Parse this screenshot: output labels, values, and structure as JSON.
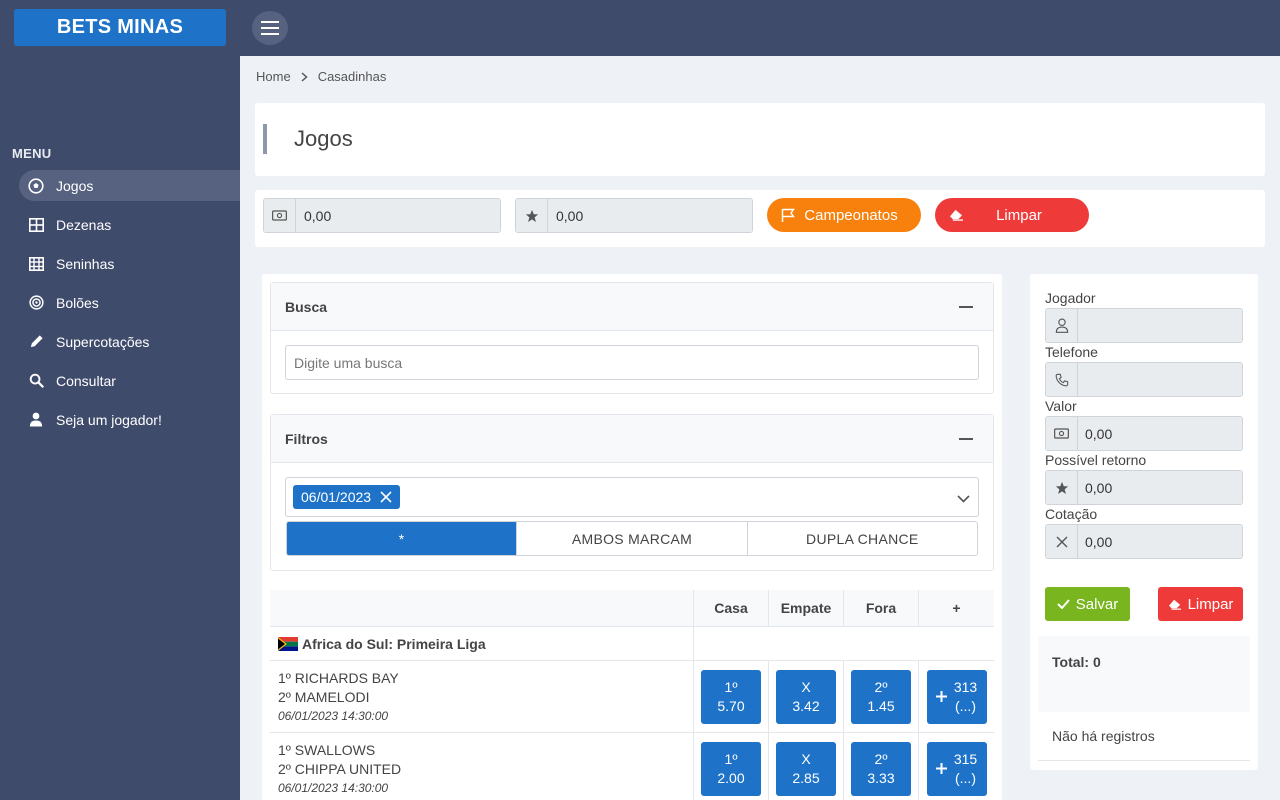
{
  "brand": "BETS MINAS",
  "sidebar": {
    "menu_label": "MENU",
    "items": [
      {
        "label": "Jogos",
        "icon": "soccer-ball-icon"
      },
      {
        "label": "Dezenas",
        "icon": "grid-icon"
      },
      {
        "label": "Seninhas",
        "icon": "table-icon"
      },
      {
        "label": "Bolões",
        "icon": "target-icon"
      },
      {
        "label": "Supercotações",
        "icon": "pencil-icon"
      },
      {
        "label": "Consultar",
        "icon": "search-icon"
      },
      {
        "label": "Seja um jogador!",
        "icon": "user-icon"
      }
    ]
  },
  "breadcrumb": {
    "home": "Home",
    "current": "Casadinhas"
  },
  "page_title": "Jogos",
  "toolbar": {
    "valor": "0,00",
    "retorno": "0,00",
    "campeonatos_label": "Campeonatos",
    "limpar_label": "Limpar"
  },
  "busca": {
    "title": "Busca",
    "placeholder": "Digite uma busca"
  },
  "filtros": {
    "title": "Filtros",
    "selected_date": "06/01/2023",
    "tabs": [
      "*",
      "AMBOS MARCAM",
      "DUPLA CHANCE"
    ]
  },
  "games_table": {
    "headers": [
      "Casa",
      "Empate",
      "Fora",
      "+"
    ],
    "league": "Africa do Sul: Primeira Liga",
    "rows": [
      {
        "home": "1º RICHARDS BAY",
        "away": "2º MAMELODI",
        "datetime": "06/01/2023 14:30:00",
        "casa": {
          "label": "1º",
          "odd": "5.70"
        },
        "empate": {
          "label": "X",
          "odd": "3.42"
        },
        "fora": {
          "label": "2º",
          "odd": "1.45"
        },
        "more": {
          "count": "313",
          "suffix": "(...)"
        }
      },
      {
        "home": "1º SWALLOWS",
        "away": "2º CHIPPA UNITED",
        "datetime": "06/01/2023 14:30:00",
        "casa": {
          "label": "1º",
          "odd": "2.00"
        },
        "empate": {
          "label": "X",
          "odd": "2.85"
        },
        "fora": {
          "label": "2º",
          "odd": "3.33"
        },
        "more": {
          "count": "315",
          "suffix": "(...)"
        }
      }
    ]
  },
  "bet_slip": {
    "jogador_label": "Jogador",
    "jogador_value": "",
    "telefone_label": "Telefone",
    "telefone_value": "",
    "valor_label": "Valor",
    "valor_value": "0,00",
    "retorno_label": "Possível retorno",
    "retorno_value": "0,00",
    "cotacao_label": "Cotação",
    "cotacao_value": "0,00",
    "salvar_label": "Salvar",
    "limpar_label": "Limpar",
    "total": "Total: 0",
    "empty": "Não há registros"
  },
  "colors": {
    "topbar": "#3f4b6b",
    "primary": "#1e73c8",
    "orange": "#f7810c",
    "red": "#ef3a3a",
    "green": "#79b51e"
  }
}
